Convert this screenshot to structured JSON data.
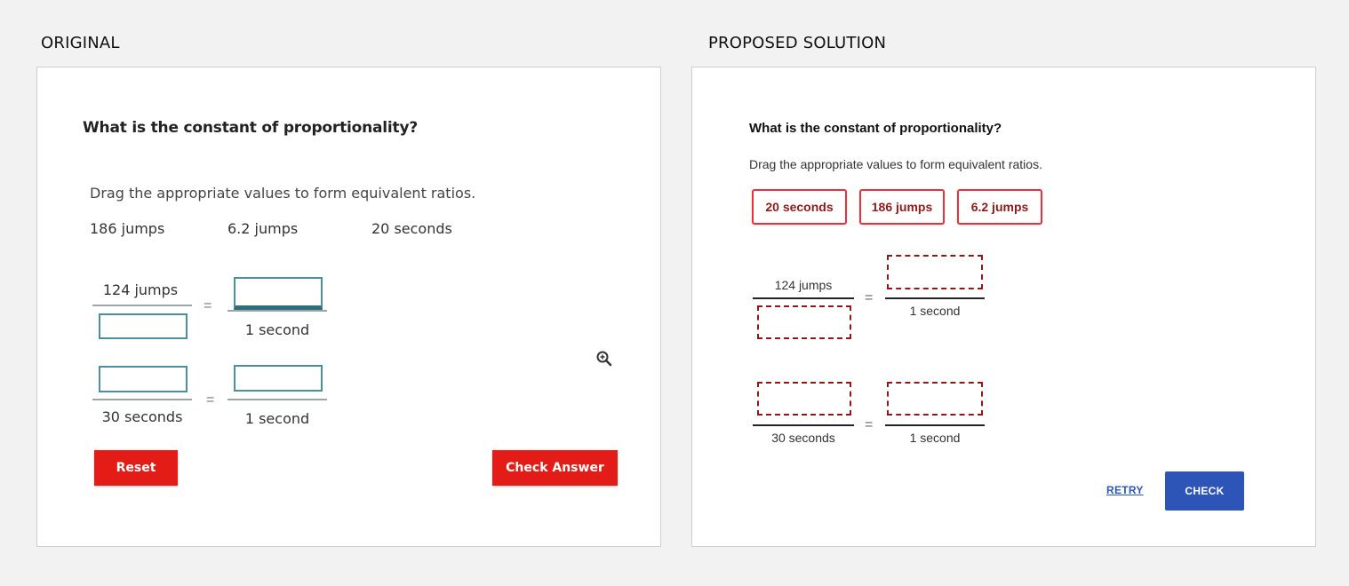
{
  "labels": {
    "original": "ORIGINAL",
    "proposed": "PROPOSED SOLUTION"
  },
  "original": {
    "title": "What is the constant of proportionality?",
    "instruction": "Drag the appropriate values to form equivalent ratios.",
    "values": [
      "186 jumps",
      "6.2 jumps",
      "20 seconds"
    ],
    "ratio1": {
      "numerator": "124 jumps",
      "right_denominator": "1 second"
    },
    "ratio2": {
      "left_denominator": "30 seconds",
      "right_denominator": "1 second"
    },
    "equals": "=",
    "reset_label": "Reset",
    "check_label": "Check Answer",
    "accent_color": "#e31c17",
    "box_color": "#4a8f99",
    "zoom_icon": "zoom-in-icon"
  },
  "proposed": {
    "title": "What is the constant of proportionality?",
    "instruction": "Drag the appropriate values to form equivalent ratios.",
    "chips": [
      "20 seconds",
      "186 jumps",
      "6.2 jumps"
    ],
    "ratio1": {
      "numerator": "124 jumps",
      "right_denominator": "1 second"
    },
    "ratio2": {
      "left_denominator": "30 seconds",
      "right_denominator": "1 second"
    },
    "equals": "=",
    "retry_label": "RETRY",
    "check_label": "CHECK",
    "chip_border_color": "#e8323a",
    "dropzone_color": "#8b1a1a",
    "check_color": "#2d55b7"
  }
}
